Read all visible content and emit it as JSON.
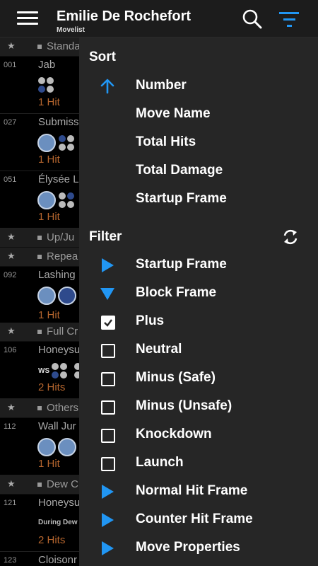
{
  "header": {
    "title": "Emilie De Rochefort",
    "subtitle": "Movelist"
  },
  "colors": {
    "accent": "#2196f3",
    "hits": "#b5652e",
    "drawer_bg": "#262626"
  },
  "move_list": {
    "sections": [
      "Standa",
      "Up/Ju",
      "Repea",
      "Full Cr",
      "Others",
      "Dew C"
    ],
    "moves": [
      {
        "num": "001",
        "name": "Jab",
        "hits": "1 Hit"
      },
      {
        "num": "027",
        "name": "Submiss",
        "hits": "1 Hit"
      },
      {
        "num": "051",
        "name": "Élysée L",
        "hits": "1 Hit"
      },
      {
        "num": "092",
        "name": "Lashing",
        "hits": "1 Hit"
      },
      {
        "num": "106",
        "name": "Honeysu",
        "prefix": "WS",
        "hits": "2 Hits"
      },
      {
        "num": "112",
        "name": "Wall Jur",
        "hits": "1 Hit"
      },
      {
        "num": "121",
        "name": "Honeysu",
        "note": "During Dew (",
        "hits": "2 Hits"
      },
      {
        "num": "123",
        "name": "Cloisonr"
      }
    ]
  },
  "drawer": {
    "sort_heading": "Sort",
    "sort_items": [
      "Number",
      "Move Name",
      "Total Hits",
      "Total Damage",
      "Startup Frame"
    ],
    "filter_heading": "Filter",
    "filter_items": [
      "Startup Frame",
      "Block Frame",
      "Plus",
      "Neutral",
      "Minus (Safe)",
      "Minus (Unsafe)",
      "Knockdown",
      "Launch",
      "Normal Hit Frame",
      "Counter Hit Frame",
      "Move Properties"
    ],
    "active_sort": "Number",
    "checked_filters": [
      "Plus"
    ],
    "expanded_filters": [
      "Block Frame"
    ]
  }
}
